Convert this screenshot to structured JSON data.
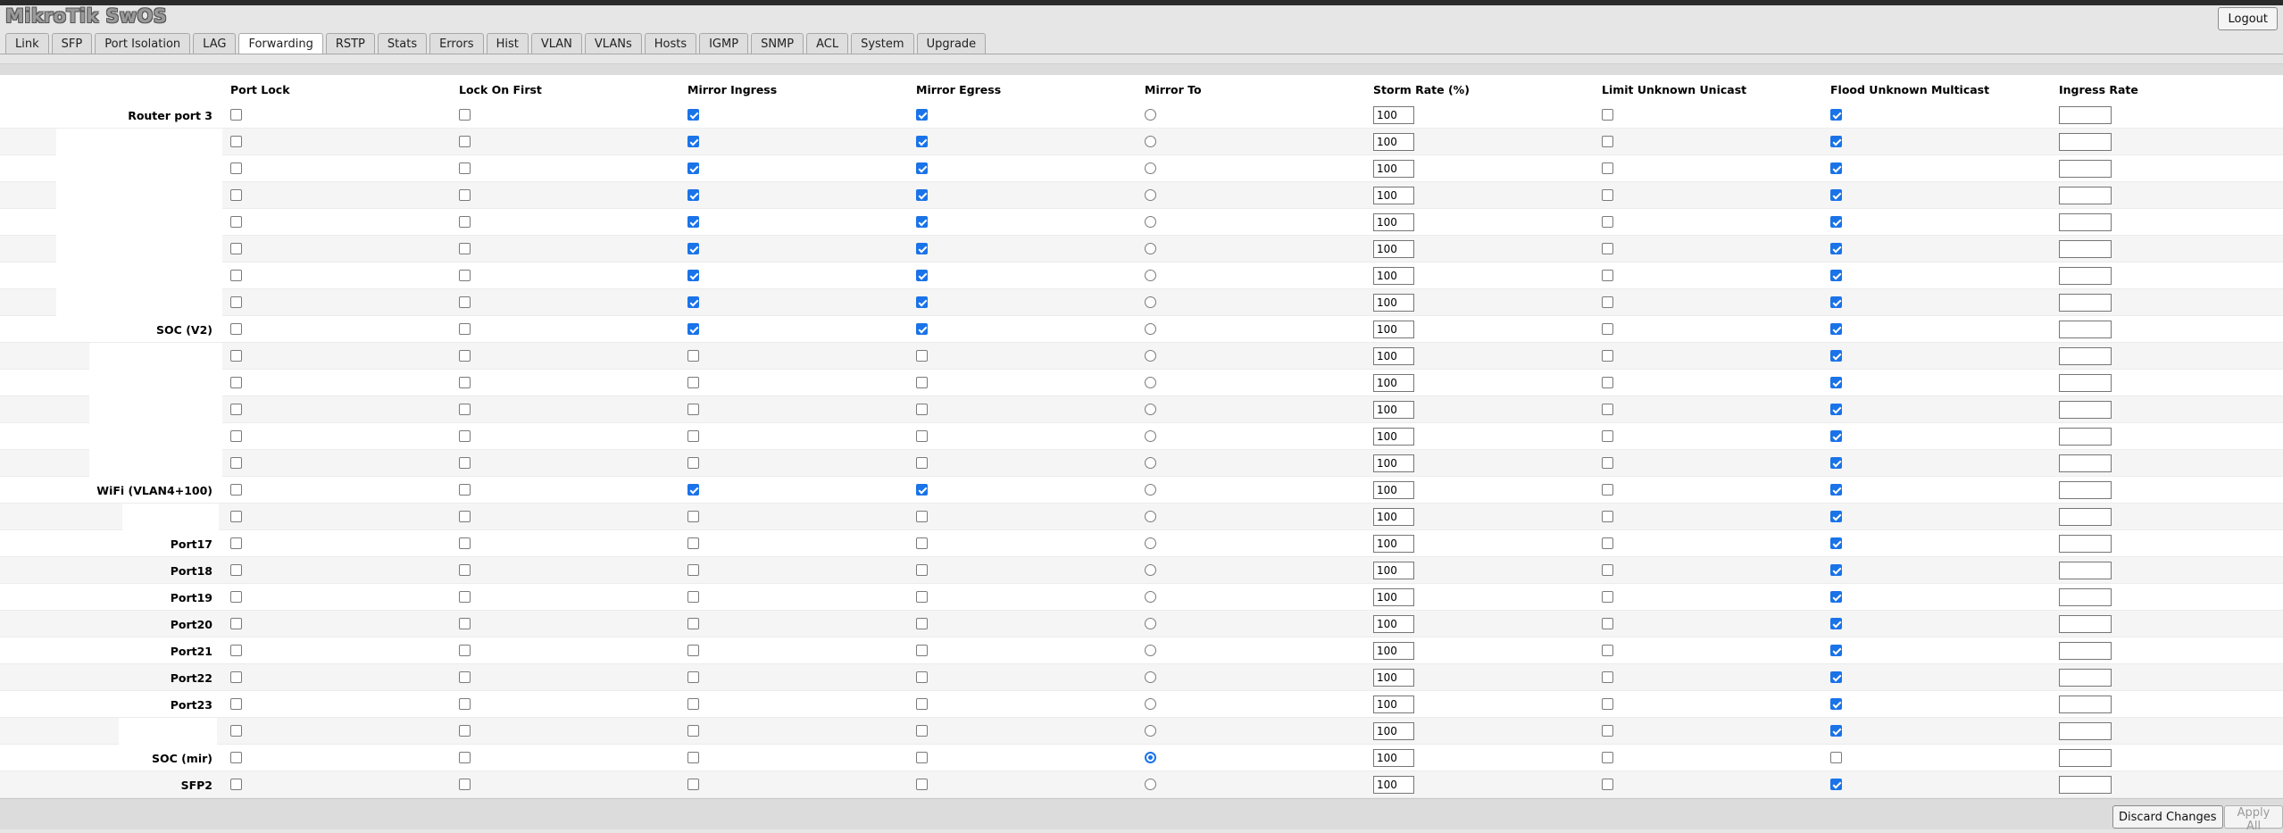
{
  "app": {
    "title": "MikroTik SwOS",
    "logout_label": "Logout"
  },
  "tabs": [
    "Link",
    "SFP",
    "Port Isolation",
    "LAG",
    "Forwarding",
    "RSTP",
    "Stats",
    "Errors",
    "Hist",
    "VLAN",
    "VLANs",
    "Hosts",
    "IGMP",
    "SNMP",
    "ACL",
    "System",
    "Upgrade"
  ],
  "active_tab": "Forwarding",
  "columns": [
    "Port Lock",
    "Lock On First",
    "Mirror Ingress",
    "Mirror Egress",
    "Mirror To",
    "Storm Rate (%)",
    "Limit Unknown Unicast",
    "Flood Unknown Multicast",
    "Ingress Rate"
  ],
  "ports": [
    {
      "name": "Router port 3",
      "port_lock": false,
      "lock_on_first": false,
      "mirror_ingress": true,
      "mirror_egress": true,
      "mirror_to": false,
      "storm_rate": "100",
      "limit_unknown_unicast": false,
      "flood_unknown_multicast": true,
      "ingress_rate": ""
    },
    {
      "name": "",
      "port_lock": false,
      "lock_on_first": false,
      "mirror_ingress": true,
      "mirror_egress": true,
      "mirror_to": false,
      "storm_rate": "100",
      "limit_unknown_unicast": false,
      "flood_unknown_multicast": true,
      "ingress_rate": ""
    },
    {
      "name": "",
      "port_lock": false,
      "lock_on_first": false,
      "mirror_ingress": true,
      "mirror_egress": true,
      "mirror_to": false,
      "storm_rate": "100",
      "limit_unknown_unicast": false,
      "flood_unknown_multicast": true,
      "ingress_rate": ""
    },
    {
      "name": "",
      "port_lock": false,
      "lock_on_first": false,
      "mirror_ingress": true,
      "mirror_egress": true,
      "mirror_to": false,
      "storm_rate": "100",
      "limit_unknown_unicast": false,
      "flood_unknown_multicast": true,
      "ingress_rate": ""
    },
    {
      "name": "",
      "port_lock": false,
      "lock_on_first": false,
      "mirror_ingress": true,
      "mirror_egress": true,
      "mirror_to": false,
      "storm_rate": "100",
      "limit_unknown_unicast": false,
      "flood_unknown_multicast": true,
      "ingress_rate": ""
    },
    {
      "name": "",
      "port_lock": false,
      "lock_on_first": false,
      "mirror_ingress": true,
      "mirror_egress": true,
      "mirror_to": false,
      "storm_rate": "100",
      "limit_unknown_unicast": false,
      "flood_unknown_multicast": true,
      "ingress_rate": ""
    },
    {
      "name": "",
      "port_lock": false,
      "lock_on_first": false,
      "mirror_ingress": true,
      "mirror_egress": true,
      "mirror_to": false,
      "storm_rate": "100",
      "limit_unknown_unicast": false,
      "flood_unknown_multicast": true,
      "ingress_rate": ""
    },
    {
      "name": "",
      "port_lock": false,
      "lock_on_first": false,
      "mirror_ingress": true,
      "mirror_egress": true,
      "mirror_to": false,
      "storm_rate": "100",
      "limit_unknown_unicast": false,
      "flood_unknown_multicast": true,
      "ingress_rate": ""
    },
    {
      "name": "SOC (V2)",
      "port_lock": false,
      "lock_on_first": false,
      "mirror_ingress": true,
      "mirror_egress": true,
      "mirror_to": false,
      "storm_rate": "100",
      "limit_unknown_unicast": false,
      "flood_unknown_multicast": true,
      "ingress_rate": ""
    },
    {
      "name": "",
      "port_lock": false,
      "lock_on_first": false,
      "mirror_ingress": false,
      "mirror_egress": false,
      "mirror_to": false,
      "storm_rate": "100",
      "limit_unknown_unicast": false,
      "flood_unknown_multicast": true,
      "ingress_rate": ""
    },
    {
      "name": "",
      "port_lock": false,
      "lock_on_first": false,
      "mirror_ingress": false,
      "mirror_egress": false,
      "mirror_to": false,
      "storm_rate": "100",
      "limit_unknown_unicast": false,
      "flood_unknown_multicast": true,
      "ingress_rate": ""
    },
    {
      "name": "",
      "port_lock": false,
      "lock_on_first": false,
      "mirror_ingress": false,
      "mirror_egress": false,
      "mirror_to": false,
      "storm_rate": "100",
      "limit_unknown_unicast": false,
      "flood_unknown_multicast": true,
      "ingress_rate": ""
    },
    {
      "name": "",
      "port_lock": false,
      "lock_on_first": false,
      "mirror_ingress": false,
      "mirror_egress": false,
      "mirror_to": false,
      "storm_rate": "100",
      "limit_unknown_unicast": false,
      "flood_unknown_multicast": true,
      "ingress_rate": ""
    },
    {
      "name": "",
      "port_lock": false,
      "lock_on_first": false,
      "mirror_ingress": false,
      "mirror_egress": false,
      "mirror_to": false,
      "storm_rate": "100",
      "limit_unknown_unicast": false,
      "flood_unknown_multicast": true,
      "ingress_rate": ""
    },
    {
      "name": "WiFi (VLAN4+100)",
      "port_lock": false,
      "lock_on_first": false,
      "mirror_ingress": true,
      "mirror_egress": true,
      "mirror_to": false,
      "storm_rate": "100",
      "limit_unknown_unicast": false,
      "flood_unknown_multicast": true,
      "ingress_rate": ""
    },
    {
      "name": "",
      "port_lock": false,
      "lock_on_first": false,
      "mirror_ingress": false,
      "mirror_egress": false,
      "mirror_to": false,
      "storm_rate": "100",
      "limit_unknown_unicast": false,
      "flood_unknown_multicast": true,
      "ingress_rate": ""
    },
    {
      "name": "Port17",
      "port_lock": false,
      "lock_on_first": false,
      "mirror_ingress": false,
      "mirror_egress": false,
      "mirror_to": false,
      "storm_rate": "100",
      "limit_unknown_unicast": false,
      "flood_unknown_multicast": true,
      "ingress_rate": ""
    },
    {
      "name": "Port18",
      "port_lock": false,
      "lock_on_first": false,
      "mirror_ingress": false,
      "mirror_egress": false,
      "mirror_to": false,
      "storm_rate": "100",
      "limit_unknown_unicast": false,
      "flood_unknown_multicast": true,
      "ingress_rate": ""
    },
    {
      "name": "Port19",
      "port_lock": false,
      "lock_on_first": false,
      "mirror_ingress": false,
      "mirror_egress": false,
      "mirror_to": false,
      "storm_rate": "100",
      "limit_unknown_unicast": false,
      "flood_unknown_multicast": true,
      "ingress_rate": ""
    },
    {
      "name": "Port20",
      "port_lock": false,
      "lock_on_first": false,
      "mirror_ingress": false,
      "mirror_egress": false,
      "mirror_to": false,
      "storm_rate": "100",
      "limit_unknown_unicast": false,
      "flood_unknown_multicast": true,
      "ingress_rate": ""
    },
    {
      "name": "Port21",
      "port_lock": false,
      "lock_on_first": false,
      "mirror_ingress": false,
      "mirror_egress": false,
      "mirror_to": false,
      "storm_rate": "100",
      "limit_unknown_unicast": false,
      "flood_unknown_multicast": true,
      "ingress_rate": ""
    },
    {
      "name": "Port22",
      "port_lock": false,
      "lock_on_first": false,
      "mirror_ingress": false,
      "mirror_egress": false,
      "mirror_to": false,
      "storm_rate": "100",
      "limit_unknown_unicast": false,
      "flood_unknown_multicast": true,
      "ingress_rate": ""
    },
    {
      "name": "Port23",
      "port_lock": false,
      "lock_on_first": false,
      "mirror_ingress": false,
      "mirror_egress": false,
      "mirror_to": false,
      "storm_rate": "100",
      "limit_unknown_unicast": false,
      "flood_unknown_multicast": true,
      "ingress_rate": ""
    },
    {
      "name": "",
      "port_lock": false,
      "lock_on_first": false,
      "mirror_ingress": false,
      "mirror_egress": false,
      "mirror_to": false,
      "storm_rate": "100",
      "limit_unknown_unicast": false,
      "flood_unknown_multicast": true,
      "ingress_rate": ""
    },
    {
      "name": "SOC (mir)",
      "port_lock": false,
      "lock_on_first": false,
      "mirror_ingress": false,
      "mirror_egress": false,
      "mirror_to": true,
      "storm_rate": "100",
      "limit_unknown_unicast": false,
      "flood_unknown_multicast": false,
      "ingress_rate": ""
    },
    {
      "name": "SFP2",
      "port_lock": false,
      "lock_on_first": false,
      "mirror_ingress": false,
      "mirror_egress": false,
      "mirror_to": false,
      "storm_rate": "100",
      "limit_unknown_unicast": false,
      "flood_unknown_multicast": true,
      "ingress_rate": ""
    }
  ],
  "footer": {
    "discard_label": "Discard Changes",
    "apply_label": "Apply All"
  },
  "colors": {
    "accent": "#1a73e8",
    "band": "#dcdcdc",
    "row_alt": "#f5f5f5"
  }
}
